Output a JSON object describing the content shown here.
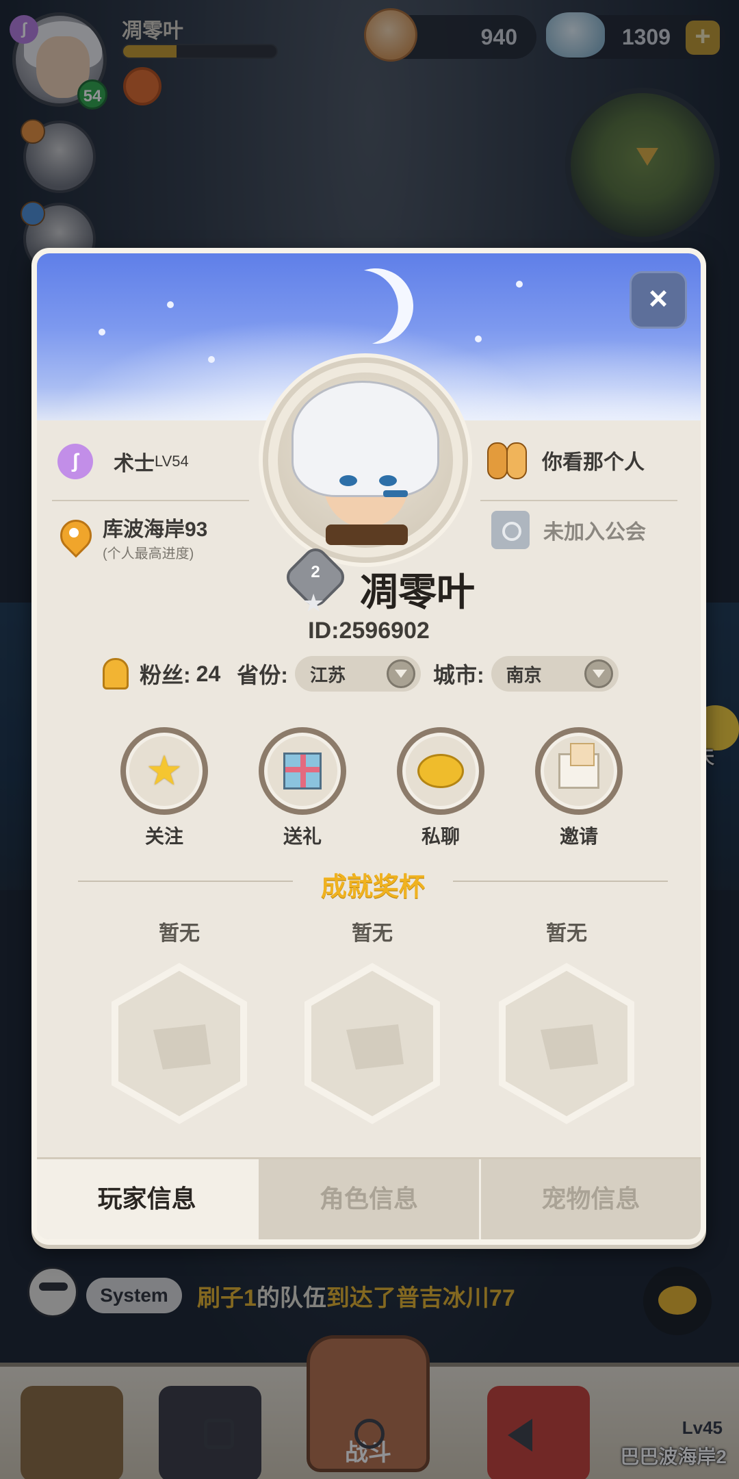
{
  "hud": {
    "player_name": "凋零叶",
    "level": "54",
    "exp_progress": 0.35,
    "shells": "940",
    "gems": "1309",
    "gem_add": "+"
  },
  "profile": {
    "close": "×",
    "class_icon": "ʃ",
    "class_name": "术士",
    "class_level": "LV54",
    "location": "库波海岸93",
    "location_note": "(个人最高进度)",
    "mate": "你看那个人",
    "guild": "未加入公会",
    "rank": "2",
    "name": "凋零叶",
    "id": "ID:2596902",
    "fans_label": "粉丝:",
    "fans_value": "24",
    "province_label": "省份:",
    "province_value": "江苏",
    "city_label": "城市:",
    "city_value": "南京",
    "actions": [
      {
        "label": "关注",
        "icon": "star-icon"
      },
      {
        "label": "送礼",
        "icon": "gift-icon"
      },
      {
        "label": "私聊",
        "icon": "chat-bubble-icon"
      },
      {
        "label": "邀请",
        "icon": "mail-icon"
      }
    ],
    "achievements_title": "成就奖杯",
    "trophies": [
      "暂无",
      "暂无",
      "暂无"
    ],
    "tabs": [
      "玩家信息",
      "角色信息",
      "宠物信息"
    ],
    "active_tab": 0
  },
  "side_chat": {
    "label": "聊天"
  },
  "system_message": {
    "tag": "System",
    "team": "刷子1",
    "mid1": "的队伍",
    "mid2": "到达了",
    "place": "普吉冰川77"
  },
  "bottom_nav": {
    "battle": "战斗",
    "locked_level": "Lv45",
    "locked_area": "巴巴波海岸2"
  },
  "colors": {
    "accent_gold": "#f0b21f",
    "panel_bg": "#ece7de",
    "level_badge": "#2fa84a"
  }
}
